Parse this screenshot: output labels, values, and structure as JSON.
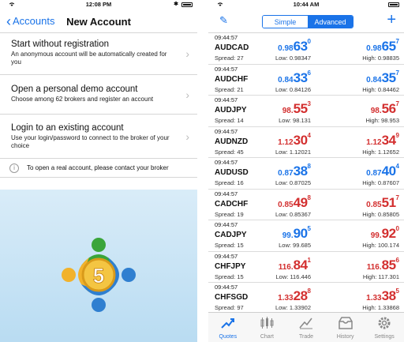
{
  "left_phone": {
    "status": {
      "time": "12:08 PM"
    },
    "nav": {
      "back_label": "Accounts",
      "title": "New Account"
    },
    "options": [
      {
        "title": "Start without registration",
        "subtitle": "An anonymous account will be automatically created for you"
      },
      {
        "title": "Open a personal demo account",
        "subtitle": "Choose among 62 brokers and register an account"
      },
      {
        "title": "Login to an existing account",
        "subtitle": "Use your login/password to connect to the broker of your choice"
      }
    ],
    "info_text": "To open a real account, please contact your broker",
    "logo_number": "5"
  },
  "right_phone": {
    "status": {
      "time": "10:44 AM"
    },
    "segments": {
      "simple": "Simple",
      "advanced": "Advanced",
      "selected": "Advanced"
    },
    "colors": {
      "up": "#1a73e8",
      "down": "#d32f2f",
      "accent": "#1a73e8"
    },
    "quotes": [
      {
        "time": "09:44:57",
        "symbol": "AUDCAD",
        "spread": "Spread: 27",
        "dir": "up",
        "bid": {
          "small": "0.98",
          "big": "63",
          "pip": "0"
        },
        "ask": {
          "small": "0.98",
          "big": "65",
          "pip": "7"
        },
        "low": "Low: 0.98347",
        "high": "High: 0.98835"
      },
      {
        "time": "09:44:57",
        "symbol": "AUDCHF",
        "spread": "Spread: 21",
        "dir": "up",
        "bid": {
          "small": "0.84",
          "big": "33",
          "pip": "6"
        },
        "ask": {
          "small": "0.84",
          "big": "35",
          "pip": "7"
        },
        "low": "Low: 0.84126",
        "high": "High: 0.84462"
      },
      {
        "time": "09:44:57",
        "symbol": "AUDJPY",
        "spread": "Spread: 14",
        "dir": "down",
        "bid": {
          "small": "98.",
          "big": "55",
          "pip": "3"
        },
        "ask": {
          "small": "98.",
          "big": "56",
          "pip": "7"
        },
        "low": "Low: 98.131",
        "high": "High: 98.953"
      },
      {
        "time": "09:44:57",
        "symbol": "AUDNZD",
        "spread": "Spread: 45",
        "dir": "down",
        "bid": {
          "small": "1.12",
          "big": "30",
          "pip": "4"
        },
        "ask": {
          "small": "1.12",
          "big": "34",
          "pip": "9"
        },
        "low": "Low: 1.12021",
        "high": "High: 1.12652"
      },
      {
        "time": "09:44:57",
        "symbol": "AUDUSD",
        "spread": "Spread: 16",
        "dir": "up",
        "bid": {
          "small": "0.87",
          "big": "38",
          "pip": "8"
        },
        "ask": {
          "small": "0.87",
          "big": "40",
          "pip": "4"
        },
        "low": "Low: 0.87025",
        "high": "High: 0.87607"
      },
      {
        "time": "09:44:57",
        "symbol": "CADCHF",
        "spread": "Spread: 19",
        "dir": "down",
        "bid": {
          "small": "0.85",
          "big": "49",
          "pip": "8"
        },
        "ask": {
          "small": "0.85",
          "big": "51",
          "pip": "7"
        },
        "low": "Low: 0.85367",
        "high": "High: 0.85805"
      },
      {
        "time": "09:44:57",
        "symbol": "CADJPY",
        "spread": "Spread: 15",
        "dir": "mixed",
        "bid": {
          "small": "99.",
          "big": "90",
          "pip": "5"
        },
        "ask": {
          "small": "99.",
          "big": "92",
          "pip": "0"
        },
        "low": "Low: 99.685",
        "high": "High: 100.174"
      },
      {
        "time": "09:44:57",
        "symbol": "CHFJPY",
        "spread": "Spread: 15",
        "dir": "down",
        "bid": {
          "small": "116.",
          "big": "84",
          "pip": "1"
        },
        "ask": {
          "small": "116.",
          "big": "85",
          "pip": "6"
        },
        "low": "Low: 116.446",
        "high": "High: 117.301"
      },
      {
        "time": "09:44:57",
        "symbol": "CHFSGD",
        "spread": "Spread: 97",
        "dir": "down",
        "bid": {
          "small": "1.33",
          "big": "28",
          "pip": "8"
        },
        "ask": {
          "small": "1.33",
          "big": "38",
          "pip": "5"
        },
        "low": "Low: 1.33902",
        "high": "High: 1.33868"
      }
    ],
    "tabs": [
      {
        "label": "Quotes",
        "icon": "quotes-icon",
        "active": true
      },
      {
        "label": "Chart",
        "icon": "chart-icon",
        "active": false
      },
      {
        "label": "Trade",
        "icon": "trade-icon",
        "active": false
      },
      {
        "label": "History",
        "icon": "history-icon",
        "active": false
      },
      {
        "label": "Settings",
        "icon": "settings-icon",
        "active": false
      }
    ]
  }
}
